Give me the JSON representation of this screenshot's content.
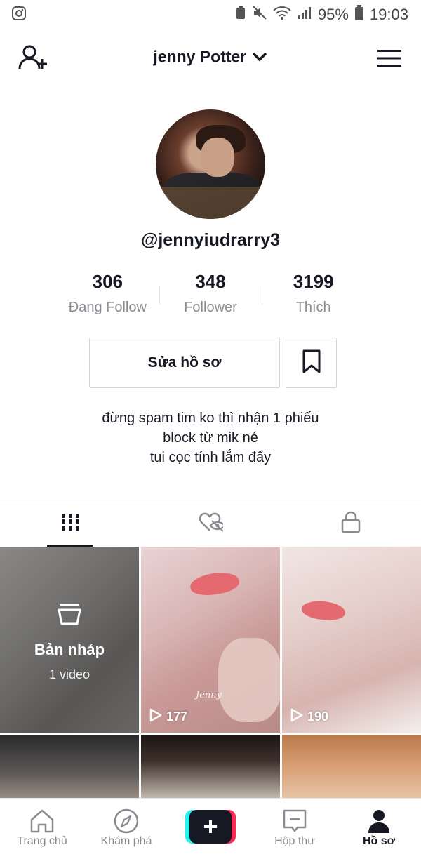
{
  "status_bar": {
    "battery": "95%",
    "time": "19:03"
  },
  "header": {
    "title": "jenny Potter"
  },
  "profile": {
    "handle": "@jennyiudrarry3",
    "stats": [
      {
        "value": "306",
        "label": "Đang Follow"
      },
      {
        "value": "348",
        "label": "Follower"
      },
      {
        "value": "3199",
        "label": "Thích"
      }
    ],
    "edit_label": "Sửa hồ sơ",
    "bio": [
      "đừng spam tim ko thì nhận 1 phiếu",
      "block từ mik né",
      "tui cọc tính lắm đấy"
    ]
  },
  "videos": {
    "draft": {
      "title": "Bản nháp",
      "count": "1 video"
    },
    "items": [
      {
        "views": "177",
        "watermark": "Jenny"
      },
      {
        "views": "190"
      }
    ]
  },
  "nav": {
    "home": "Trang chủ",
    "discover": "Khám phá",
    "create": "+",
    "inbox": "Hộp thư",
    "profile": "Hồ sơ"
  },
  "colors": {
    "accent_red": "#fe2c55",
    "accent_cyan": "#25f4ee",
    "text": "#161823",
    "muted": "#8a8b91"
  }
}
